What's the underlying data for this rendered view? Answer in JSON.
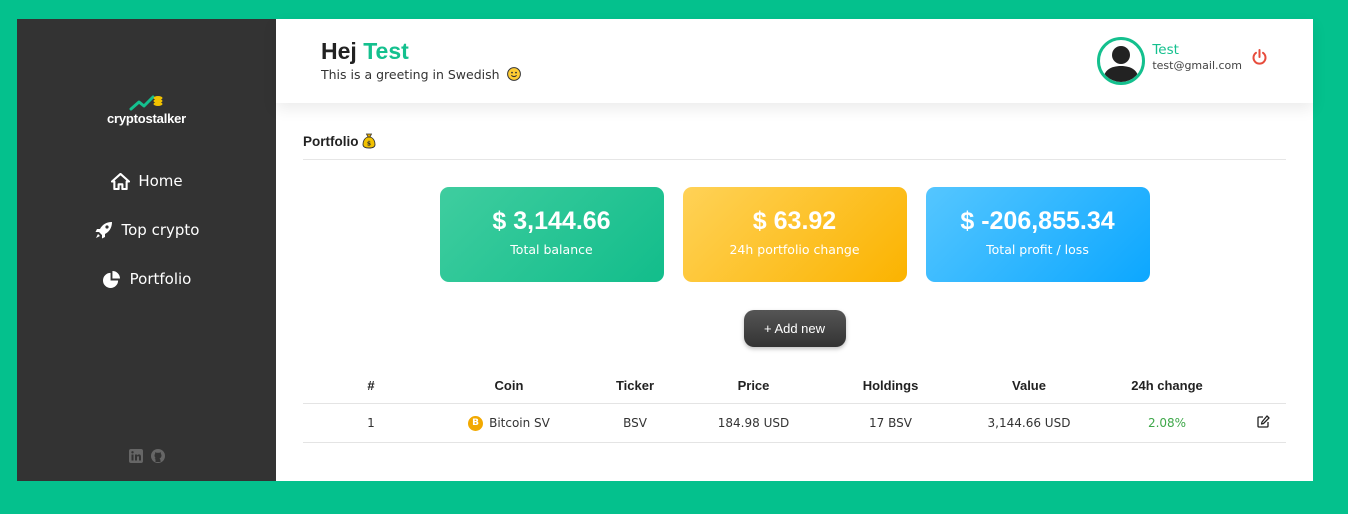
{
  "sidebar": {
    "logo_text": "cryptostalker",
    "nav": [
      {
        "label": "Home",
        "icon": "home-icon"
      },
      {
        "label": "Top crypto",
        "icon": "rocket-icon"
      },
      {
        "label": "Portfolio",
        "icon": "pie-chart-icon"
      }
    ],
    "social": [
      "linkedin-icon",
      "github-icon"
    ]
  },
  "header": {
    "greeting_prefix": "Hej",
    "greeting_name": "Test",
    "subtitle": "This is a greeting in Swedish",
    "user_name": "Test",
    "user_email": "test@gmail.com"
  },
  "portfolio": {
    "title": "Portfolio",
    "cards": [
      {
        "value": "$ 3,144.66",
        "label": "Total balance",
        "color": "#12bd8b"
      },
      {
        "value": "$ 63.92",
        "label": "24h portfolio change",
        "color": "#fbb300"
      },
      {
        "value": "$ -206,855.34",
        "label": "Total profit / loss",
        "color": "#0ca7ff"
      }
    ],
    "add_label": "+ Add new",
    "table": {
      "headers": [
        "#",
        "Coin",
        "Ticker",
        "Price",
        "Holdings",
        "Value",
        "24h change"
      ],
      "rows": [
        {
          "num": "1",
          "coin": "Bitcoin SV",
          "ticker": "BSV",
          "price": "184.98 USD",
          "holdings": "17 BSV",
          "value": "3,144.66 USD",
          "change": "2.08%"
        }
      ]
    }
  },
  "colors": {
    "accent": "#14c08e",
    "background": "#04c18d",
    "sidebar": "#333333",
    "positive": "#3fa84a",
    "logout": "#e74c3c"
  }
}
